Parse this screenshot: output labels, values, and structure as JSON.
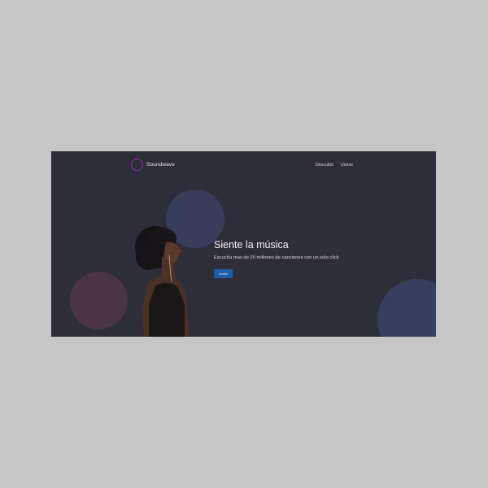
{
  "brand": {
    "name": "Soundwave",
    "logo_icon": "soundwave-logo-icon",
    "accent_gradient": [
      "#2d5fb0",
      "#a0358d"
    ]
  },
  "nav": {
    "items": [
      {
        "label": "Descubrir"
      },
      {
        "label": "Unirse"
      }
    ]
  },
  "hero": {
    "title": "Siente la música",
    "subtitle": "Escucha mas de 20 millones de canciones con un solo click",
    "cta_label": "Unirse",
    "cta_color": "#1c5fa8"
  },
  "colors": {
    "background": "#2e2d3a",
    "blob_blue": "#373f5c",
    "blob_pink": "#4a3446"
  }
}
